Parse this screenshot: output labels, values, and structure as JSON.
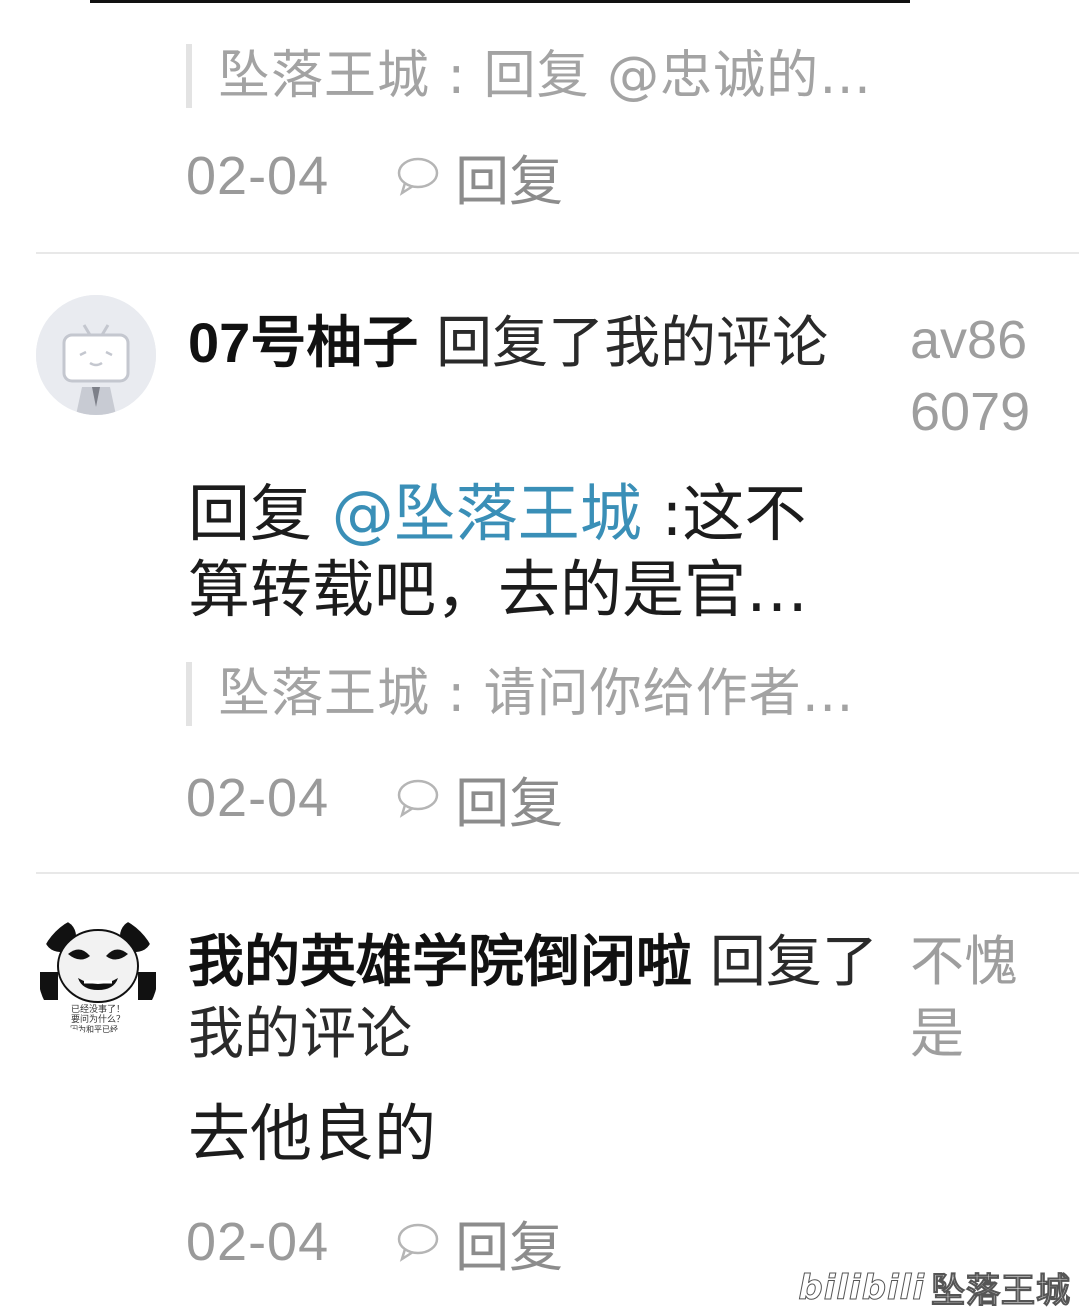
{
  "items": [
    {
      "quote": "坠落王城 : 回复 @忠诚的…",
      "date": "02-04",
      "reply_label": "回复"
    },
    {
      "username": "07号柚子",
      "action": "回复了我的评论",
      "side_text": "av866079",
      "reply_prefix": "回复 ",
      "mention": "@坠落王城",
      "body": " :这不算转载吧，去的是官…",
      "quote": "坠落王城 : 请问你给作者…",
      "date": "02-04",
      "reply_label": "回复"
    },
    {
      "username": "我的英雄学院倒闭啦",
      "action": "回复了我的评论",
      "side_text": "不愧是",
      "avatar_caption": "已经没事了！ 要问为什么？ 因为和平已经…",
      "body": "去他良的",
      "date": "02-04",
      "reply_label": "回复"
    }
  ],
  "watermark": {
    "logo": "bilibili",
    "user": "坠落王城"
  },
  "colors": {
    "mention": "#3a8fb7",
    "muted": "#9a9a9a",
    "divider": "#e8e8e8"
  }
}
